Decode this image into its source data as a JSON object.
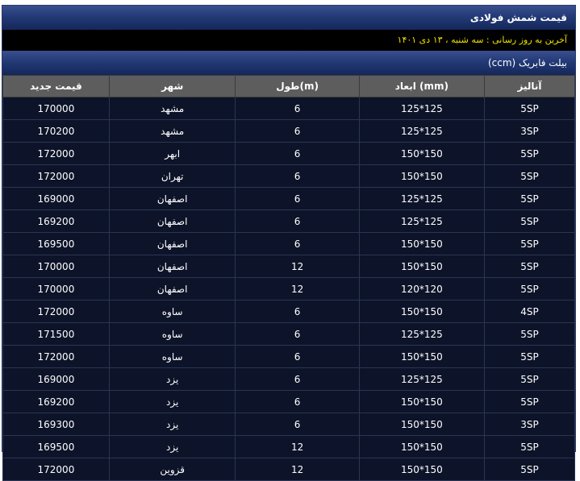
{
  "header": {
    "title": "قیمت شمش فولادی"
  },
  "update_line": "آخرین به روز رسانی : سه شنبه ، ۱۳ دی ۱۴۰۱",
  "section_title": "بیلت فابریک (ccm)",
  "table": {
    "columns": [
      "قیمت جدید",
      "شهر",
      "طول(m)",
      "ابعاد (mm)",
      "آنالیز"
    ],
    "rows": [
      [
        "170000",
        "مشهد",
        "6",
        "125*125",
        "5SP"
      ],
      [
        "170200",
        "مشهد",
        "6",
        "125*125",
        "3SP"
      ],
      [
        "172000",
        "ابهر",
        "6",
        "150*150",
        "5SP"
      ],
      [
        "172000",
        "تهران",
        "6",
        "150*150",
        "5SP"
      ],
      [
        "169000",
        "اصفهان",
        "6",
        "125*125",
        "5SP"
      ],
      [
        "169200",
        "اصفهان",
        "6",
        "125*125",
        "5SP"
      ],
      [
        "169500",
        "اصفهان",
        "6",
        "150*150",
        "5SP"
      ],
      [
        "170000",
        "اصفهان",
        "12",
        "150*150",
        "5SP"
      ],
      [
        "170000",
        "اصفهان",
        "12",
        "120*120",
        "5SP"
      ],
      [
        "172000",
        "ساوه",
        "6",
        "150*150",
        "4SP"
      ],
      [
        "171500",
        "ساوه",
        "6",
        "125*125",
        "5SP"
      ],
      [
        "172000",
        "ساوه",
        "6",
        "150*150",
        "5SP"
      ],
      [
        "169000",
        "یزد",
        "6",
        "125*125",
        "5SP"
      ],
      [
        "169200",
        "یزد",
        "6",
        "150*150",
        "5SP"
      ],
      [
        "169300",
        "یزد",
        "6",
        "150*150",
        "3SP"
      ],
      [
        "169500",
        "یزد",
        "12",
        "150*150",
        "5SP"
      ],
      [
        "172000",
        "قزوین",
        "12",
        "150*150",
        "5SP"
      ]
    ]
  }
}
